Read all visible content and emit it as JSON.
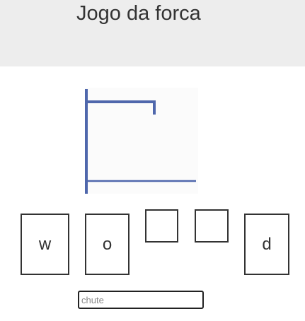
{
  "header": {
    "title": "Jogo da forca"
  },
  "word": {
    "slots": [
      {
        "letter": "w"
      },
      {
        "letter": "o"
      },
      {
        "letter": ""
      },
      {
        "letter": ""
      },
      {
        "letter": "d"
      }
    ]
  },
  "guess": {
    "placeholder": "chute",
    "value": ""
  },
  "hangman": {
    "errors": 0
  },
  "colors": {
    "header_bg": "#ededed",
    "gallows": "#4f67ac",
    "text": "#333333"
  }
}
